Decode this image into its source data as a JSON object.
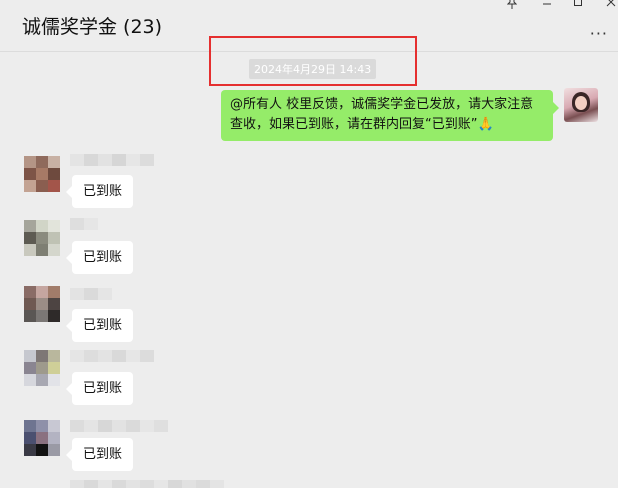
{
  "header": {
    "title": "诚儒奖学金 (23)",
    "window_controls": [
      "pin-icon",
      "minimize-icon",
      "maximize-icon",
      "close-icon"
    ],
    "more_icon": "more-icon"
  },
  "timestamp": "2024年4月29日 14:43",
  "outgoing_message": {
    "text": "@所有人 校里反馈，诚儒奖学金已发放，请大家注意查收，如果已到账，请在群内回复“已到账”🙏"
  },
  "incoming_messages": [
    {
      "text": "已到账"
    },
    {
      "text": "已到账"
    },
    {
      "text": "已到账"
    },
    {
      "text": "已到账"
    },
    {
      "text": "已到账"
    }
  ],
  "colors": {
    "outgoing_bubble": "#95ec69",
    "incoming_bubble": "#ffffff",
    "background": "#ededed",
    "highlight_box": "#e52f2f"
  }
}
